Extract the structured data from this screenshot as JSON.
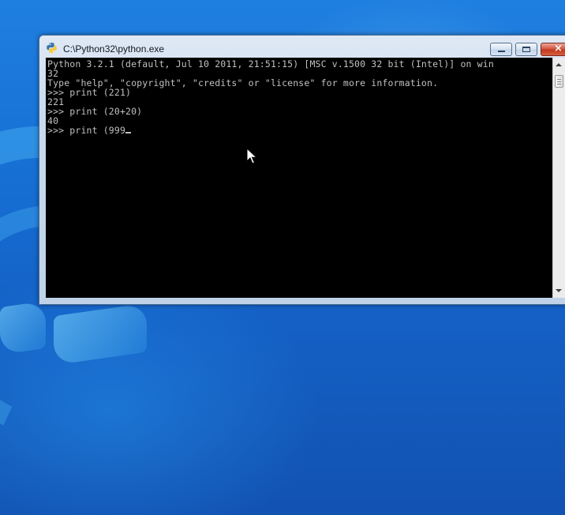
{
  "window": {
    "title": "C:\\Python32\\python.exe",
    "icon": "python-icon"
  },
  "console": {
    "lines": [
      "Python 3.2.1 (default, Jul 10 2011, 21:51:15) [MSC v.1500 32 bit (Intel)] on win",
      "32",
      "Type \"help\", \"copyright\", \"credits\" or \"license\" for more information.",
      ">>> print (221)",
      "221",
      ">>> print (20+20)",
      "40"
    ],
    "current_input": ">>> print (999"
  },
  "colors": {
    "console_bg": "#000000",
    "console_fg": "#c0c0c0",
    "close_button": "#c0381f"
  }
}
